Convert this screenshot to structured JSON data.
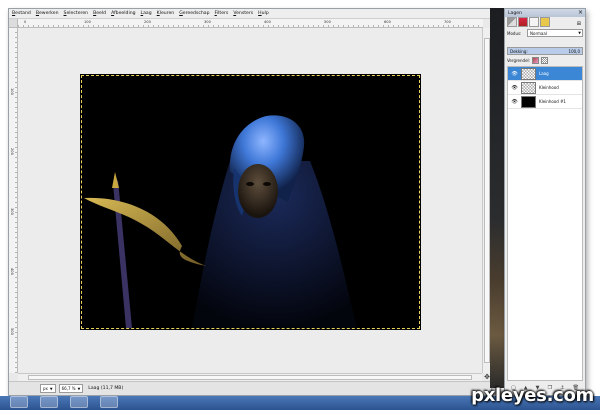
{
  "menubar": {
    "items": [
      "Bestand",
      "Bewerken",
      "Selecteren",
      "Beeld",
      "Afbeelding",
      "Laag",
      "Kleuren",
      "Gereedschap",
      "Filters",
      "Vensters",
      "Hulp"
    ]
  },
  "rulers": {
    "top": [
      "0",
      "100",
      "200",
      "300",
      "400",
      "500",
      "600",
      "700"
    ],
    "left": [
      "100",
      "200",
      "300",
      "400",
      "500"
    ]
  },
  "statusbar": {
    "unit": "px",
    "zoom": "66,7 %",
    "message": "Laag (11,7 MB)"
  },
  "layers_dock": {
    "title": "Lagen",
    "mode_label": "Modus:",
    "mode_value": "Normaal",
    "opacity_label": "Dekking:",
    "opacity_value": "100,0",
    "lock_label": "Vergrendel:",
    "layers": [
      {
        "name": "Laag",
        "selected": true
      },
      {
        "name": "Kleinhood",
        "selected": false
      },
      {
        "name": "Kleinhood #1",
        "selected": false
      }
    ]
  },
  "watermark": {
    "text": "pxleyes.com"
  },
  "colors": {
    "selection": "#3b87d6",
    "hood_blue": "#3f78d8",
    "scythe_gold": "#c9a842",
    "taskbar": "#3a64a4"
  }
}
